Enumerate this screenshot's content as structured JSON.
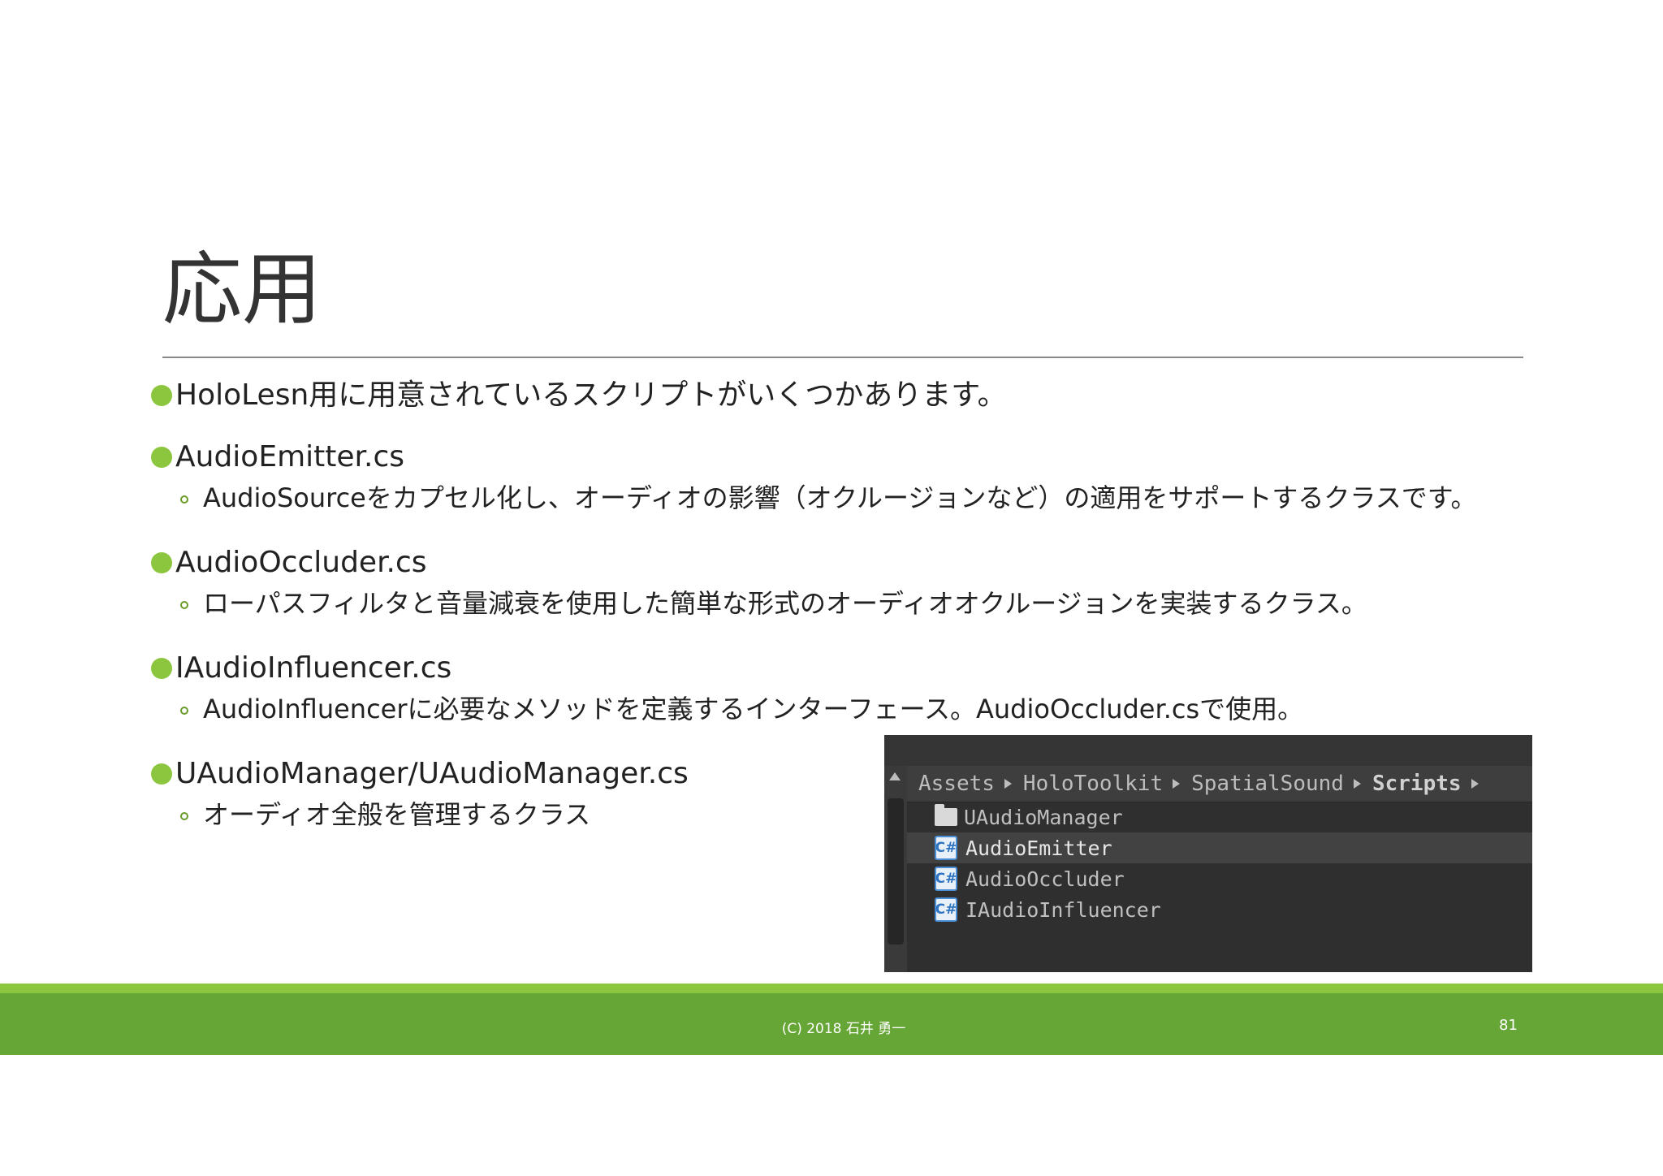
{
  "slide": {
    "title": "応用",
    "bullets": [
      {
        "text": "HoloLesn用に用意されているスクリプトがいくつかあります。",
        "subs": []
      },
      {
        "text": "AudioEmitter.cs",
        "subs": [
          "AudioSourceをカプセル化し、オーディオの影響（オクルージョンなど）の適用をサポートするクラスです。"
        ]
      },
      {
        "text": "AudioOccluder.cs",
        "subs": [
          "ローパスフィルタと音量減衰を使用した簡単な形式のオーディオオクルージョンを実装するクラス。"
        ]
      },
      {
        "text": "IAudioInfluencer.cs",
        "subs": [
          "AudioInfluencerに必要なメソッドを定義するインターフェース。AudioOccluder.csで使用。"
        ]
      },
      {
        "text": "UAudioManager/UAudioManager.cs",
        "subs": [
          "オーディオ全般を管理するクラス"
        ]
      }
    ]
  },
  "unity_panel": {
    "breadcrumb": [
      "Assets",
      "HoloToolkit",
      "SpatialSound",
      "Scripts"
    ],
    "items": [
      {
        "label": "UAudioManager",
        "icon": "folder-icon"
      },
      {
        "label": "AudioEmitter",
        "icon": "csharp-script-icon"
      },
      {
        "label": "AudioOccluder",
        "icon": "csharp-script-icon"
      },
      {
        "label": "IAudioInfluencer",
        "icon": "csharp-script-icon"
      }
    ],
    "selected_index": 1,
    "cs_glyph": "C#"
  },
  "footer": {
    "copyright": "(C) 2018 石井 勇一",
    "page_number": "81"
  },
  "colors": {
    "accent_green": "#8cc63f",
    "footer_green": "#66a636",
    "panel_bg": "#2f2f2f"
  }
}
